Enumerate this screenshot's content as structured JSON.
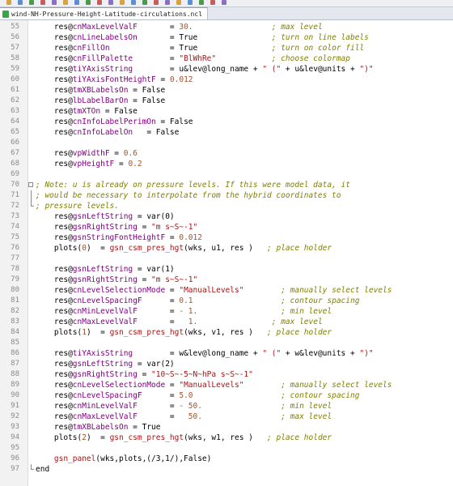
{
  "window": {
    "tab_title": "wind-NH-Pressure-Height-Latitude-circulations.ncl"
  },
  "toolbar": {
    "icons": [
      "new-file-icon",
      "open-file-icon",
      "save-icon",
      "save-all-icon",
      "close-icon",
      "print-icon",
      "cut-icon",
      "copy-icon",
      "paste-icon",
      "undo-icon",
      "redo-icon",
      "find-icon",
      "replace-icon",
      "zoom-in-icon",
      "zoom-out-icon",
      "sync-icon",
      "wrap-icon",
      "indent-icon",
      "bookmark-icon",
      "macro-icon"
    ]
  },
  "editor": {
    "lines": [
      {
        "n": "55",
        "tokens": [
          [
            "    ",
            ""
          ],
          [
            "res",
            "var"
          ],
          [
            "@",
            "at"
          ],
          [
            "cnMaxLevelValF",
            "attr"
          ],
          [
            "       = ",
            ""
          ],
          [
            "30.",
            "num"
          ],
          [
            "                 ",
            ""
          ],
          [
            "; max level",
            "com"
          ]
        ]
      },
      {
        "n": "56",
        "tokens": [
          [
            "    ",
            ""
          ],
          [
            "res",
            "var"
          ],
          [
            "@",
            "at"
          ],
          [
            "cnLineLabelsOn",
            "attr"
          ],
          [
            "       = ",
            ""
          ],
          [
            "True",
            "kw"
          ],
          [
            "                ",
            ""
          ],
          [
            "; turn on line labels",
            "com"
          ]
        ]
      },
      {
        "n": "57",
        "tokens": [
          [
            "    ",
            ""
          ],
          [
            "res",
            "var"
          ],
          [
            "@",
            "at"
          ],
          [
            "cnFillOn",
            "attr"
          ],
          [
            "             = ",
            ""
          ],
          [
            "True",
            "kw"
          ],
          [
            "                ",
            ""
          ],
          [
            "; turn on color fill",
            "com"
          ]
        ]
      },
      {
        "n": "58",
        "tokens": [
          [
            "    ",
            ""
          ],
          [
            "res",
            "var"
          ],
          [
            "@",
            "at"
          ],
          [
            "cnFillPalette",
            "attr"
          ],
          [
            "        = ",
            ""
          ],
          [
            "\"BlWhRe\"",
            "str"
          ],
          [
            "            ",
            ""
          ],
          [
            "; choose colormap",
            "com"
          ]
        ]
      },
      {
        "n": "59",
        "tokens": [
          [
            "    ",
            ""
          ],
          [
            "res",
            "var"
          ],
          [
            "@",
            "at"
          ],
          [
            "tiYAxisString",
            "attr"
          ],
          [
            "        = ",
            ""
          ],
          [
            "u&lev@long_name + ",
            "op"
          ],
          [
            "\" (\"",
            "str"
          ],
          [
            " + u&lev@units + ",
            "op"
          ],
          [
            "\")\"",
            "str"
          ]
        ]
      },
      {
        "n": "60",
        "tokens": [
          [
            "    ",
            ""
          ],
          [
            "res",
            "var"
          ],
          [
            "@",
            "at"
          ],
          [
            "tiYAxisFontHeightF",
            "attr"
          ],
          [
            " = ",
            ""
          ],
          [
            "0.012",
            "num"
          ]
        ]
      },
      {
        "n": "61",
        "tokens": [
          [
            "    ",
            ""
          ],
          [
            "res",
            "var"
          ],
          [
            "@",
            "at"
          ],
          [
            "tmXBLabelsOn",
            "attr"
          ],
          [
            " = ",
            ""
          ],
          [
            "False",
            "kw"
          ]
        ]
      },
      {
        "n": "62",
        "tokens": [
          [
            "    ",
            ""
          ],
          [
            "res",
            "var"
          ],
          [
            "@",
            "at"
          ],
          [
            "lbLabelBarOn",
            "attr"
          ],
          [
            " = ",
            ""
          ],
          [
            "False",
            "kw"
          ]
        ]
      },
      {
        "n": "63",
        "tokens": [
          [
            "    ",
            ""
          ],
          [
            "res",
            "var"
          ],
          [
            "@",
            "at"
          ],
          [
            "tmXTOn",
            "attr"
          ],
          [
            " = ",
            ""
          ],
          [
            "False",
            "kw"
          ]
        ]
      },
      {
        "n": "64",
        "tokens": [
          [
            "    ",
            ""
          ],
          [
            "res",
            "var"
          ],
          [
            "@",
            "at"
          ],
          [
            "cnInfoLabelPerimOn",
            "attr"
          ],
          [
            " = ",
            ""
          ],
          [
            "False",
            "kw"
          ]
        ]
      },
      {
        "n": "65",
        "tokens": [
          [
            "    ",
            ""
          ],
          [
            "res",
            "var"
          ],
          [
            "@",
            "at"
          ],
          [
            "cnInfoLabelOn",
            "attr"
          ],
          [
            "   = ",
            ""
          ],
          [
            "False",
            "kw"
          ]
        ]
      },
      {
        "n": "66",
        "tokens": []
      },
      {
        "n": "67",
        "tokens": [
          [
            "    ",
            ""
          ],
          [
            "res",
            "var"
          ],
          [
            "@",
            "at"
          ],
          [
            "vpWidthF",
            "attr"
          ],
          [
            " = ",
            ""
          ],
          [
            "0.6",
            "num"
          ]
        ]
      },
      {
        "n": "68",
        "tokens": [
          [
            "    ",
            ""
          ],
          [
            "res",
            "var"
          ],
          [
            "@",
            "at"
          ],
          [
            "vpHeightF",
            "attr"
          ],
          [
            " = ",
            ""
          ],
          [
            "0.2",
            "num"
          ]
        ]
      },
      {
        "n": "69",
        "tokens": []
      },
      {
        "n": "70",
        "fold": "open",
        "tokens": [
          [
            "; Note: u is already on pressure levels. If this were model data, it",
            "com"
          ]
        ]
      },
      {
        "n": "71",
        "fold": "bar",
        "tokens": [
          [
            "; would be necessary to interpolate from the hybrid coordinates to",
            "com"
          ]
        ]
      },
      {
        "n": "72",
        "fold": "end",
        "tokens": [
          [
            "; pressure levels.",
            "com"
          ]
        ]
      },
      {
        "n": "73",
        "tokens": [
          [
            "    ",
            ""
          ],
          [
            "res",
            "var"
          ],
          [
            "@",
            "at"
          ],
          [
            "gsnLeftString",
            "attr"
          ],
          [
            " = ",
            ""
          ],
          [
            "var(0)",
            "op"
          ]
        ]
      },
      {
        "n": "74",
        "tokens": [
          [
            "    ",
            ""
          ],
          [
            "res",
            "var"
          ],
          [
            "@",
            "at"
          ],
          [
            "gsnRightString",
            "attr"
          ],
          [
            " = ",
            ""
          ],
          [
            "\"m s~S~-1\"",
            "str"
          ]
        ]
      },
      {
        "n": "75",
        "tokens": [
          [
            "    ",
            ""
          ],
          [
            "res",
            "var"
          ],
          [
            "@",
            "at"
          ],
          [
            "gsnStringFontHeightF",
            "attr"
          ],
          [
            " = ",
            ""
          ],
          [
            "0.012",
            "num"
          ]
        ]
      },
      {
        "n": "76",
        "tokens": [
          [
            "    ",
            ""
          ],
          [
            "plots(",
            "op"
          ],
          [
            "0",
            "num"
          ],
          [
            ")  = ",
            ""
          ],
          [
            "gsn_csm_pres_hgt",
            "fn"
          ],
          [
            "(wks, u1, res )",
            "op"
          ],
          [
            "   ",
            ""
          ],
          [
            "; place holder",
            "com"
          ]
        ]
      },
      {
        "n": "77",
        "tokens": []
      },
      {
        "n": "78",
        "tokens": [
          [
            "    ",
            ""
          ],
          [
            "res",
            "var"
          ],
          [
            "@",
            "at"
          ],
          [
            "gsnLeftString",
            "attr"
          ],
          [
            " = ",
            ""
          ],
          [
            "var(1)",
            "op"
          ]
        ]
      },
      {
        "n": "79",
        "tokens": [
          [
            "    ",
            ""
          ],
          [
            "res",
            "var"
          ],
          [
            "@",
            "at"
          ],
          [
            "gsnRightString",
            "attr"
          ],
          [
            " = ",
            ""
          ],
          [
            "\"m s~S~-1\"",
            "str"
          ]
        ]
      },
      {
        "n": "80",
        "tokens": [
          [
            "    ",
            ""
          ],
          [
            "res",
            "var"
          ],
          [
            "@",
            "at"
          ],
          [
            "cnLevelSelectionMode",
            "attr"
          ],
          [
            " = ",
            ""
          ],
          [
            "\"ManualLevels\"",
            "str"
          ],
          [
            "        ",
            ""
          ],
          [
            "; manually select levels",
            "com"
          ]
        ]
      },
      {
        "n": "81",
        "tokens": [
          [
            "    ",
            ""
          ],
          [
            "res",
            "var"
          ],
          [
            "@",
            "at"
          ],
          [
            "cnLevelSpacingF",
            "attr"
          ],
          [
            "      = ",
            ""
          ],
          [
            "0.1",
            "num"
          ],
          [
            "                   ",
            ""
          ],
          [
            "; contour spacing",
            "com"
          ]
        ]
      },
      {
        "n": "82",
        "tokens": [
          [
            "    ",
            ""
          ],
          [
            "res",
            "var"
          ],
          [
            "@",
            "at"
          ],
          [
            "cnMinLevelValF",
            "attr"
          ],
          [
            "       = ",
            ""
          ],
          [
            "- 1.",
            "num"
          ],
          [
            "                  ",
            ""
          ],
          [
            "; min level",
            "com"
          ]
        ]
      },
      {
        "n": "83",
        "tokens": [
          [
            "    ",
            ""
          ],
          [
            "res",
            "var"
          ],
          [
            "@",
            "at"
          ],
          [
            "cnMaxLevelValF",
            "attr"
          ],
          [
            "       = ",
            ""
          ],
          [
            "  1.",
            "num"
          ],
          [
            "                ",
            ""
          ],
          [
            "; max level",
            "com"
          ]
        ]
      },
      {
        "n": "84",
        "tokens": [
          [
            "    ",
            ""
          ],
          [
            "plots(",
            "op"
          ],
          [
            "1",
            "num"
          ],
          [
            ")  = ",
            ""
          ],
          [
            "gsn_csm_pres_hgt",
            "fn"
          ],
          [
            "(wks, v1, res )",
            "op"
          ],
          [
            "   ",
            ""
          ],
          [
            "; place holder",
            "com"
          ]
        ]
      },
      {
        "n": "85",
        "tokens": []
      },
      {
        "n": "86",
        "tokens": [
          [
            "    ",
            ""
          ],
          [
            "res",
            "var"
          ],
          [
            "@",
            "at"
          ],
          [
            "tiYAxisString",
            "attr"
          ],
          [
            "        = ",
            ""
          ],
          [
            "w&lev@long_name + ",
            "op"
          ],
          [
            "\" (\"",
            "str"
          ],
          [
            " + w&lev@units + ",
            "op"
          ],
          [
            "\")\"",
            "str"
          ]
        ]
      },
      {
        "n": "87",
        "tokens": [
          [
            "    ",
            ""
          ],
          [
            "res",
            "var"
          ],
          [
            "@",
            "at"
          ],
          [
            "gsnLeftString",
            "attr"
          ],
          [
            " = ",
            ""
          ],
          [
            "var(2)",
            "op"
          ]
        ]
      },
      {
        "n": "88",
        "tokens": [
          [
            "    ",
            ""
          ],
          [
            "res",
            "var"
          ],
          [
            "@",
            "at"
          ],
          [
            "gsnRightString",
            "attr"
          ],
          [
            " = ",
            ""
          ],
          [
            "\"10~S~-5~N~hPa s~S~-1\"",
            "str"
          ]
        ]
      },
      {
        "n": "89",
        "tokens": [
          [
            "    ",
            ""
          ],
          [
            "res",
            "var"
          ],
          [
            "@",
            "at"
          ],
          [
            "cnLevelSelectionMode",
            "attr"
          ],
          [
            " = ",
            ""
          ],
          [
            "\"ManualLevels\"",
            "str"
          ],
          [
            "        ",
            ""
          ],
          [
            "; manually select levels",
            "com"
          ]
        ]
      },
      {
        "n": "90",
        "tokens": [
          [
            "    ",
            ""
          ],
          [
            "res",
            "var"
          ],
          [
            "@",
            "at"
          ],
          [
            "cnLevelSpacingF",
            "attr"
          ],
          [
            "      = ",
            ""
          ],
          [
            "5.0",
            "num"
          ],
          [
            "                   ",
            ""
          ],
          [
            "; contour spacing",
            "com"
          ]
        ]
      },
      {
        "n": "91",
        "tokens": [
          [
            "    ",
            ""
          ],
          [
            "res",
            "var"
          ],
          [
            "@",
            "at"
          ],
          [
            "cnMinLevelValF",
            "attr"
          ],
          [
            "       = ",
            ""
          ],
          [
            "- 50.",
            "num"
          ],
          [
            "                 ",
            ""
          ],
          [
            "; min level",
            "com"
          ]
        ]
      },
      {
        "n": "92",
        "tokens": [
          [
            "    ",
            ""
          ],
          [
            "res",
            "var"
          ],
          [
            "@",
            "at"
          ],
          [
            "cnMaxLevelValF",
            "attr"
          ],
          [
            "       = ",
            ""
          ],
          [
            "  50.",
            "num"
          ],
          [
            "                 ",
            ""
          ],
          [
            "; max level",
            "com"
          ]
        ]
      },
      {
        "n": "93",
        "tokens": [
          [
            "    ",
            ""
          ],
          [
            "res",
            "var"
          ],
          [
            "@",
            "at"
          ],
          [
            "tmXBLabelsOn",
            "attr"
          ],
          [
            " = ",
            ""
          ],
          [
            "True",
            "kw"
          ]
        ]
      },
      {
        "n": "94",
        "tokens": [
          [
            "    ",
            ""
          ],
          [
            "plots(",
            "op"
          ],
          [
            "2",
            "num"
          ],
          [
            ")  = ",
            ""
          ],
          [
            "gsn_csm_pres_hgt",
            "fn"
          ],
          [
            "(wks, w1, res )",
            "op"
          ],
          [
            "   ",
            ""
          ],
          [
            "; place holder",
            "com"
          ]
        ]
      },
      {
        "n": "95",
        "tokens": []
      },
      {
        "n": "96",
        "tokens": [
          [
            "    ",
            ""
          ],
          [
            "gsn_panel",
            "fn"
          ],
          [
            "(wks,plots,(/3,1/),False)",
            "op"
          ]
        ]
      },
      {
        "n": "97",
        "fold": "end",
        "tokens": [
          [
            "end",
            "kw"
          ]
        ]
      }
    ]
  }
}
